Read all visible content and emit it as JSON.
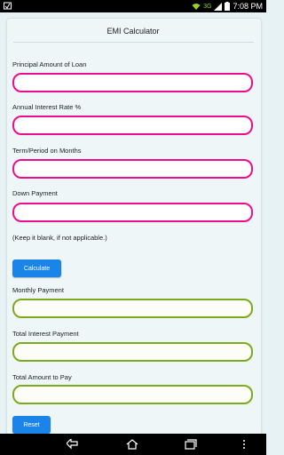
{
  "status_bar": {
    "network": "3G",
    "time": "7:08 PM"
  },
  "form": {
    "title": "EMI Calculator",
    "principal_label": "Principal Amount of Loan",
    "interest_label": "Annual Interest Rate %",
    "term_label": "Term/Period on Months",
    "down_payment_label": "Down Payment",
    "down_payment_note": "(Keep it blank, if not applicable.)",
    "calculate_label": "Calculate",
    "monthly_label": "Monthly Payment",
    "total_interest_label": "Total Interest Payment",
    "total_amount_label": "Total Amount to Pay",
    "reset_label": "Reset",
    "principal_value": "",
    "interest_value": "",
    "term_value": "",
    "down_payment_value": "",
    "monthly_value": "",
    "total_interest_value": "",
    "total_amount_value": ""
  },
  "colors": {
    "input_border": "#ee0d8f",
    "output_border": "#7caa1e",
    "button": "#1b84e8"
  },
  "nav": {
    "icons": [
      "back-icon",
      "home-icon",
      "recent-apps-icon",
      "menu-icon"
    ]
  }
}
